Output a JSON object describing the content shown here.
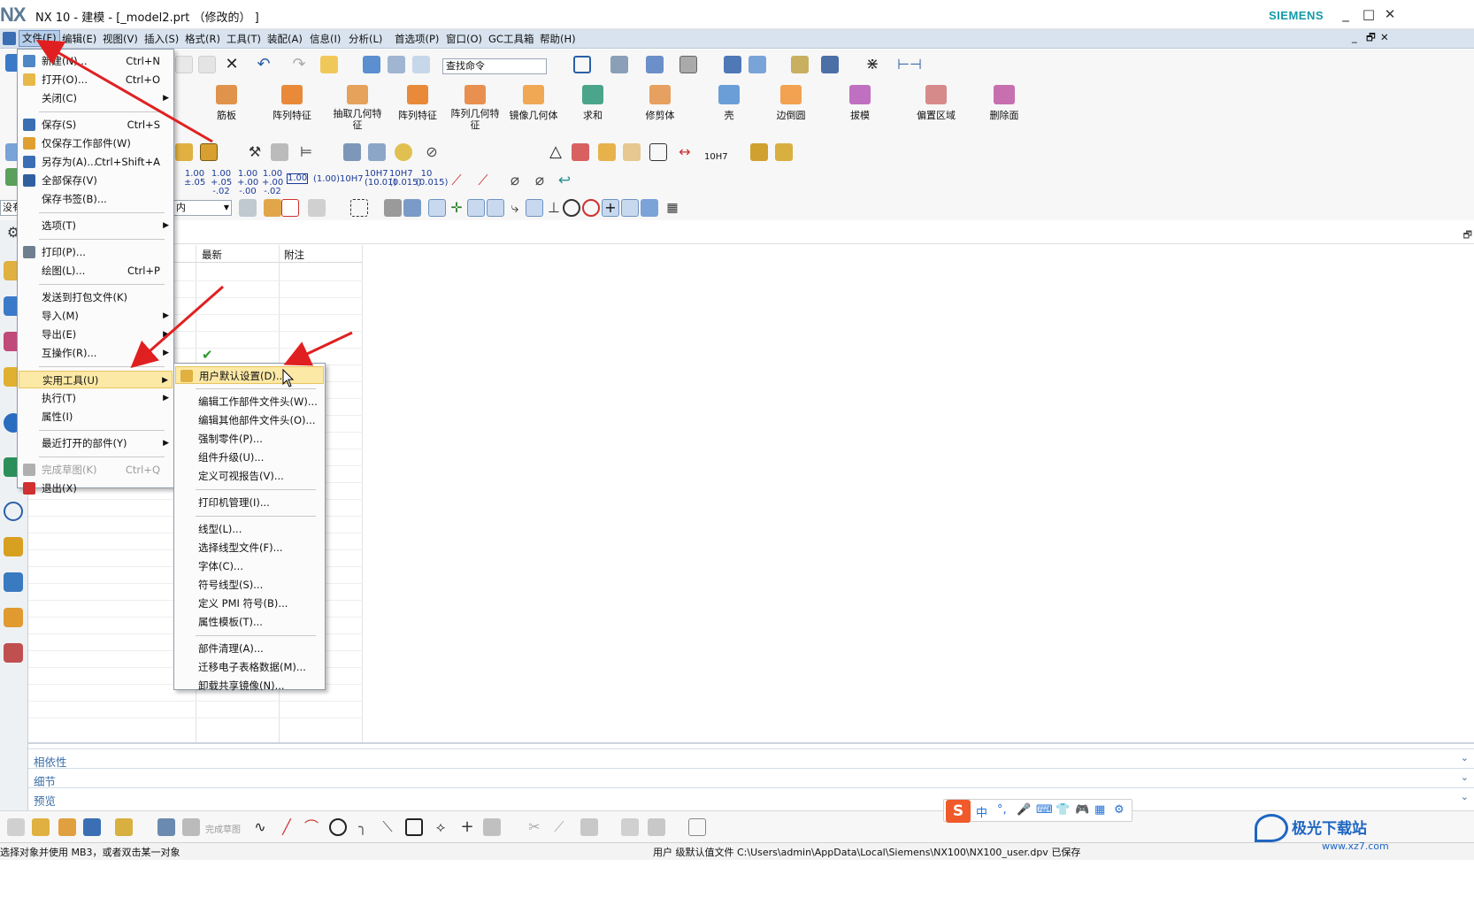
{
  "window": {
    "logo": "NX",
    "title": "NX 10 - 建模 - [_model2.prt （修改的） ]",
    "brand": "SIEMENS",
    "controls": [
      "_",
      "□",
      "✕"
    ]
  },
  "menubar": {
    "items": [
      "文件(F)",
      "编辑(E)",
      "视图(V)",
      "插入(S)",
      "格式(R)",
      "工具(T)",
      "装配(A)",
      "信息(I)",
      "分析(L)",
      "首选项(P)",
      "窗口(O)",
      "GC工具箱",
      "帮助(H)"
    ],
    "active": "文件(F)",
    "window_controls": [
      "_",
      "🗗",
      "✕"
    ]
  },
  "toolbar": {
    "search_placeholder": "查找命令",
    "feature_buttons": [
      "筋板",
      "阵列特征",
      "抽取几何特征",
      "阵列特征",
      "阵列几何特征",
      "镜像几何体",
      "求和",
      "修剪体",
      "壳",
      "边倒圆",
      "拔模",
      "偏置区域",
      "删除面"
    ],
    "dimension_values": [
      "1.00 ±.05",
      "1.00 +.05 -.02",
      "1.00 +.00 -.00",
      "1.00 +.00 -.02",
      "1.00",
      "(1.00)",
      "10H7",
      "10H7 (10.01)",
      "10H7 (0.015)",
      "10 (0.015)"
    ],
    "tolerance_label": "10H7",
    "filter_value": "没有",
    "scope_value": "内"
  },
  "table": {
    "columns": [
      "最新",
      "附注"
    ],
    "checkmark_row": 6
  },
  "file_menu": {
    "items": [
      {
        "label": "新建(N)...",
        "shortcut": "Ctrl+N",
        "icon": "new-file-icon"
      },
      {
        "label": "打开(O)...",
        "shortcut": "Ctrl+O",
        "icon": "open-folder-icon"
      },
      {
        "label": "关闭(C)",
        "submenu": true
      },
      {
        "sep": true
      },
      {
        "label": "保存(S)",
        "shortcut": "Ctrl+S",
        "icon": "save-icon"
      },
      {
        "label": "仅保存工作部件(W)",
        "icon": "save-work-part-icon"
      },
      {
        "label": "另存为(A)...",
        "shortcut": "Ctrl+Shift+A",
        "icon": "save-as-icon"
      },
      {
        "label": "全部保存(V)",
        "icon": "save-all-icon"
      },
      {
        "label": "保存书签(B)..."
      },
      {
        "sep": true
      },
      {
        "label": "选项(T)",
        "submenu": true
      },
      {
        "sep": true
      },
      {
        "label": "打印(P)...",
        "icon": "print-icon"
      },
      {
        "label": "绘图(L)...",
        "shortcut": "Ctrl+P"
      },
      {
        "sep": true
      },
      {
        "label": "发送到打包文件(K)"
      },
      {
        "label": "导入(M)",
        "submenu": true
      },
      {
        "label": "导出(E)",
        "submenu": true
      },
      {
        "label": "互操作(R)...",
        "submenu": true
      },
      {
        "sep": true
      },
      {
        "label": "实用工具(U)",
        "submenu": true,
        "highlighted": true
      },
      {
        "label": "执行(T)",
        "submenu": true
      },
      {
        "label": "属性(I)"
      },
      {
        "sep": true
      },
      {
        "label": "最近打开的部件(Y)",
        "submenu": true
      },
      {
        "sep": true
      },
      {
        "label": "完成草图(K)",
        "shortcut": "Ctrl+Q",
        "disabled": true,
        "icon": "finish-sketch-icon"
      },
      {
        "label": "退出(X)",
        "icon": "exit-icon"
      }
    ]
  },
  "utilities_menu": {
    "items": [
      {
        "label": "用户默认设置(D)...",
        "highlighted": true,
        "icon": "user-defaults-icon"
      },
      {
        "sep": true
      },
      {
        "label": "编辑工作部件文件头(W)..."
      },
      {
        "label": "编辑其他部件文件头(O)..."
      },
      {
        "label": "强制零件(P)..."
      },
      {
        "label": "组件升级(U)..."
      },
      {
        "label": "定义可视报告(V)..."
      },
      {
        "sep": true
      },
      {
        "label": "打印机管理(I)..."
      },
      {
        "sep": true
      },
      {
        "label": "线型(L)..."
      },
      {
        "label": "选择线型文件(F)..."
      },
      {
        "label": "字体(C)..."
      },
      {
        "label": "符号线型(S)..."
      },
      {
        "label": "定义 PMI 符号(B)..."
      },
      {
        "label": "属性模板(T)..."
      },
      {
        "sep": true
      },
      {
        "label": "部件清理(A)..."
      },
      {
        "label": "迁移电子表格数据(M)..."
      },
      {
        "label": "卸载共享镜像(N)..."
      }
    ]
  },
  "collapse_sections": [
    "相依性",
    "细节",
    "预览"
  ],
  "bottom_toolbar": {
    "finish_sketch_label": "完成草图"
  },
  "status": {
    "left": "选择对象并使用 MB3，或者双击某一对象",
    "right": "用户 级默认值文件 C:\\Users\\admin\\AppData\\Local\\Siemens\\NX100\\NX100_user.dpv 已保存"
  },
  "ime": {
    "logo": "S",
    "items": [
      "中",
      "°,",
      "🎤",
      "⌨",
      "👕",
      "🎮",
      "▦",
      "⚙"
    ]
  },
  "watermark": {
    "text": "极光下载站",
    "url": "www.xz7.com"
  },
  "colors": {
    "menubar": "#d8e3ef",
    "highlight": "#fde9a6",
    "accent": "#139aa7",
    "arrow": "#e02020",
    "link": "#3b6fa8"
  }
}
